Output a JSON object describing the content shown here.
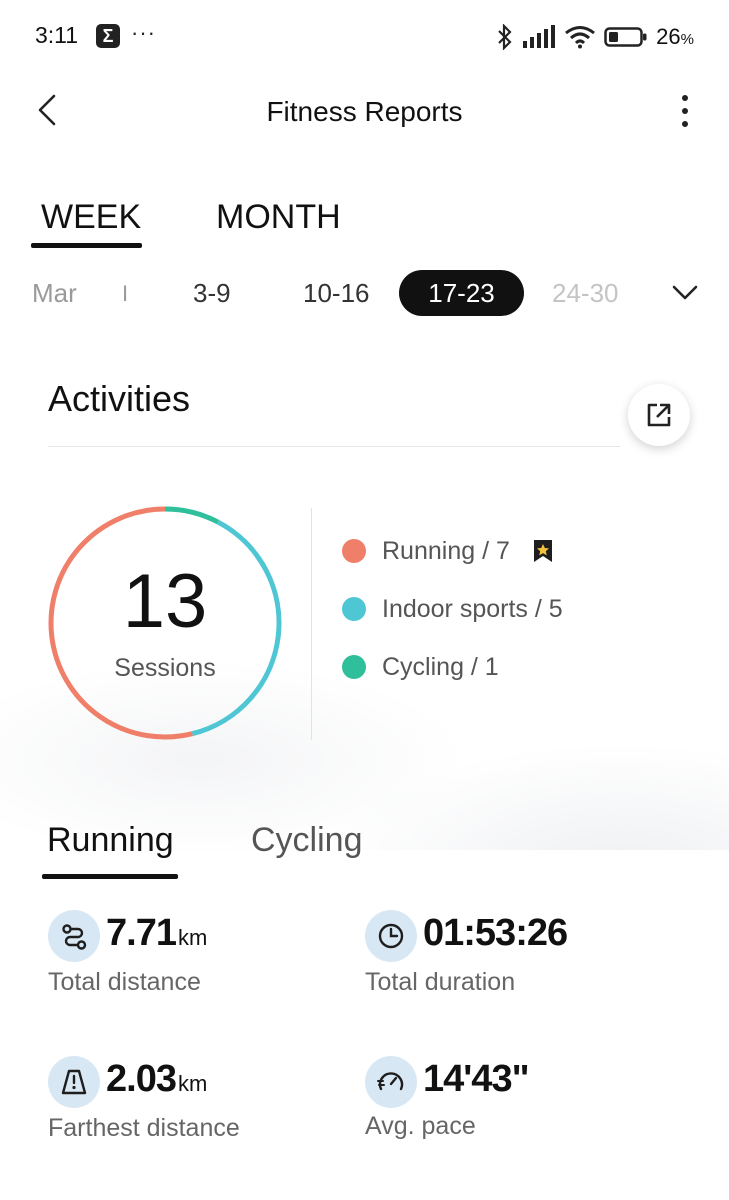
{
  "status_bar": {
    "time": "3:11",
    "app_icon": "sigma-icon",
    "more": "···",
    "battery_percent": "26",
    "battery_unit": "%"
  },
  "header": {
    "title": "Fitness Reports"
  },
  "period_tabs": [
    {
      "label": "WEEK",
      "selected": true
    },
    {
      "label": "MONTH",
      "selected": false
    }
  ],
  "week_selector": {
    "month": "Mar",
    "separator": "I",
    "weeks": [
      {
        "label": "3-9",
        "state": "normal"
      },
      {
        "label": "10-16",
        "state": "normal"
      },
      {
        "label": "17-23",
        "state": "selected"
      },
      {
        "label": "24-30",
        "state": "disabled"
      }
    ]
  },
  "activities": {
    "title": "Activities",
    "sessions_count": "13",
    "sessions_label": "Sessions",
    "legend": [
      {
        "label": "Running / 7",
        "color": "#f07f6a",
        "has_badge": true
      },
      {
        "label": "Indoor sports / 5",
        "color": "#4ec6d4"
      },
      {
        "label": "Cycling / 1",
        "color": "#2fbf9a"
      }
    ]
  },
  "chart_data": {
    "type": "pie",
    "categories": [
      "Running",
      "Indoor sports",
      "Cycling"
    ],
    "values": [
      7,
      5,
      1
    ],
    "colors": [
      "#f07f6a",
      "#4ec6d4",
      "#2fbf9a"
    ]
  },
  "sport_tabs": [
    {
      "label": "Running",
      "selected": true
    },
    {
      "label": "Cycling",
      "selected": false
    }
  ],
  "stats": [
    {
      "value": "7.71",
      "unit": "km",
      "label": "Total distance",
      "icon": "route-icon"
    },
    {
      "value": "01:53:26",
      "unit": "",
      "label": "Total duration",
      "icon": "clock-icon"
    },
    {
      "value": "2.03",
      "unit": "km",
      "label": "Farthest distance",
      "icon": "road-icon"
    },
    {
      "value": "14'43\"",
      "unit": "",
      "label": "Avg. pace",
      "icon": "speedometer-icon"
    }
  ]
}
